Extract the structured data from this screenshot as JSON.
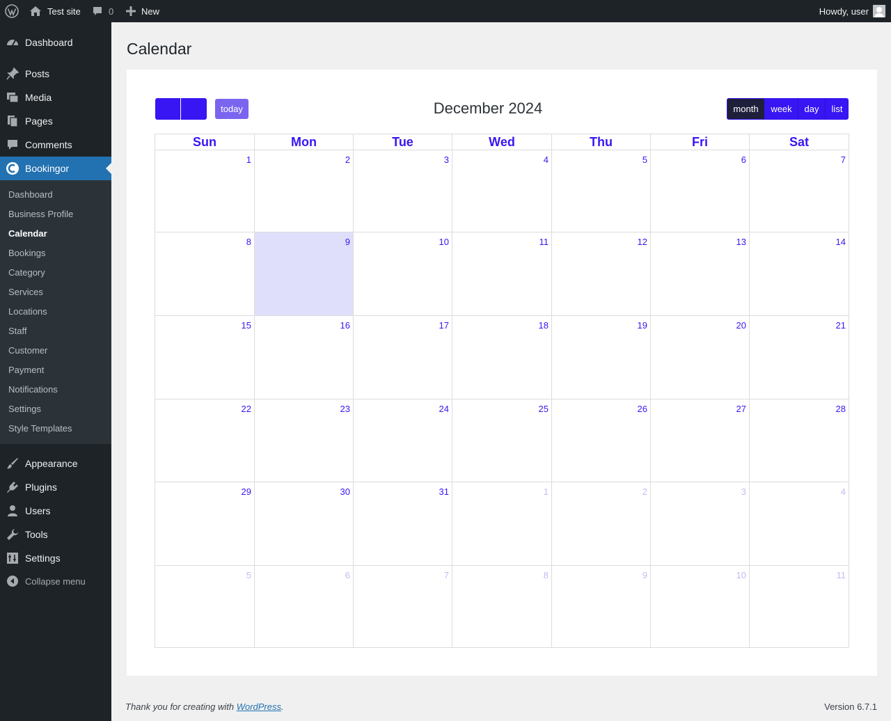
{
  "adminbar": {
    "site_name": "Test site",
    "comments_count": "0",
    "new_label": "New",
    "howdy": "Howdy, user"
  },
  "sidebar": {
    "top_items": [
      {
        "label": "Dashboard",
        "icon": "dashboard-icon"
      },
      {
        "label": "Posts",
        "icon": "pin-icon"
      },
      {
        "label": "Media",
        "icon": "media-icon"
      },
      {
        "label": "Pages",
        "icon": "pages-icon"
      },
      {
        "label": "Comments",
        "icon": "comment-icon"
      },
      {
        "label": "Bookingor",
        "icon": "bookingor-icon"
      }
    ],
    "sub_items": [
      "Dashboard",
      "Business Profile",
      "Calendar",
      "Bookings",
      "Category",
      "Services",
      "Locations",
      "Staff",
      "Customer",
      "Payment",
      "Notifications",
      "Settings",
      "Style Templates"
    ],
    "current_sub": "Calendar",
    "bottom_items": [
      {
        "label": "Appearance",
        "icon": "brush-icon"
      },
      {
        "label": "Plugins",
        "icon": "plugin-icon"
      },
      {
        "label": "Users",
        "icon": "user-icon"
      },
      {
        "label": "Tools",
        "icon": "wrench-icon"
      },
      {
        "label": "Settings",
        "icon": "settings-icon"
      }
    ],
    "collapse_label": "Collapse menu"
  },
  "page": {
    "title": "Calendar"
  },
  "calendar": {
    "title": "December 2024",
    "today_label": "today",
    "views": [
      "month",
      "week",
      "day",
      "list"
    ],
    "active_view": "month",
    "weekdays": [
      "Sun",
      "Mon",
      "Tue",
      "Wed",
      "Thu",
      "Fri",
      "Sat"
    ],
    "weeks": [
      [
        {
          "d": "1"
        },
        {
          "d": "2"
        },
        {
          "d": "3"
        },
        {
          "d": "4"
        },
        {
          "d": "5"
        },
        {
          "d": "6"
        },
        {
          "d": "7"
        }
      ],
      [
        {
          "d": "8"
        },
        {
          "d": "9",
          "today": true
        },
        {
          "d": "10"
        },
        {
          "d": "11"
        },
        {
          "d": "12"
        },
        {
          "d": "13"
        },
        {
          "d": "14"
        }
      ],
      [
        {
          "d": "15"
        },
        {
          "d": "16"
        },
        {
          "d": "17"
        },
        {
          "d": "18"
        },
        {
          "d": "19"
        },
        {
          "d": "20"
        },
        {
          "d": "21"
        }
      ],
      [
        {
          "d": "22"
        },
        {
          "d": "23"
        },
        {
          "d": "24"
        },
        {
          "d": "25"
        },
        {
          "d": "26"
        },
        {
          "d": "27"
        },
        {
          "d": "28"
        }
      ],
      [
        {
          "d": "29"
        },
        {
          "d": "30"
        },
        {
          "d": "31"
        },
        {
          "d": "1",
          "other": true
        },
        {
          "d": "2",
          "other": true
        },
        {
          "d": "3",
          "other": true
        },
        {
          "d": "4",
          "other": true
        }
      ],
      [
        {
          "d": "5",
          "other": true
        },
        {
          "d": "6",
          "other": true
        },
        {
          "d": "7",
          "other": true
        },
        {
          "d": "8",
          "other": true
        },
        {
          "d": "9",
          "other": true
        },
        {
          "d": "10",
          "other": true
        },
        {
          "d": "11",
          "other": true
        }
      ]
    ]
  },
  "footer": {
    "thanks_prefix": "Thank you for creating with ",
    "thanks_link": "WordPress",
    "thanks_suffix": ".",
    "version": "Version 6.7.1"
  },
  "colors": {
    "accent": "#3716f3",
    "today_bg": "#e0dffb",
    "admin_dark": "#1d2327",
    "wp_blue": "#2271b1"
  }
}
